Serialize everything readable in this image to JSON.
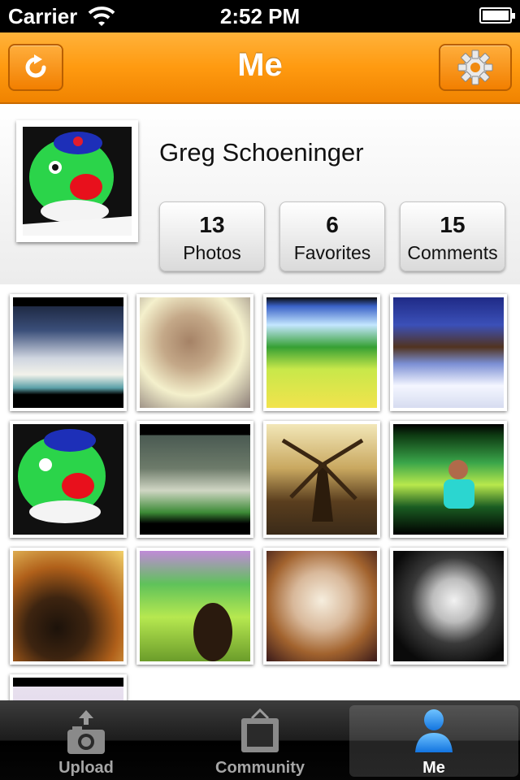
{
  "status_bar": {
    "carrier": "Carrier",
    "time": "2:52 PM"
  },
  "nav": {
    "title": "Me",
    "left_icon": "refresh-icon",
    "right_icon": "gear-icon"
  },
  "profile": {
    "name": "Greg Schoeninger",
    "stats": [
      {
        "count": "13",
        "label": "Photos"
      },
      {
        "count": "6",
        "label": "Favorites"
      },
      {
        "count": "15",
        "label": "Comments"
      }
    ]
  },
  "colors": {
    "accent": "#ff9a10",
    "nav_border": "#c96a00",
    "tab_active_icon": "#1e90ff"
  },
  "tabs": [
    {
      "label": "Upload",
      "icon": "camera-upload-icon"
    },
    {
      "label": "Community",
      "icon": "picture-frame-icon"
    },
    {
      "label": "Me",
      "icon": "person-icon",
      "active": true
    }
  ]
}
